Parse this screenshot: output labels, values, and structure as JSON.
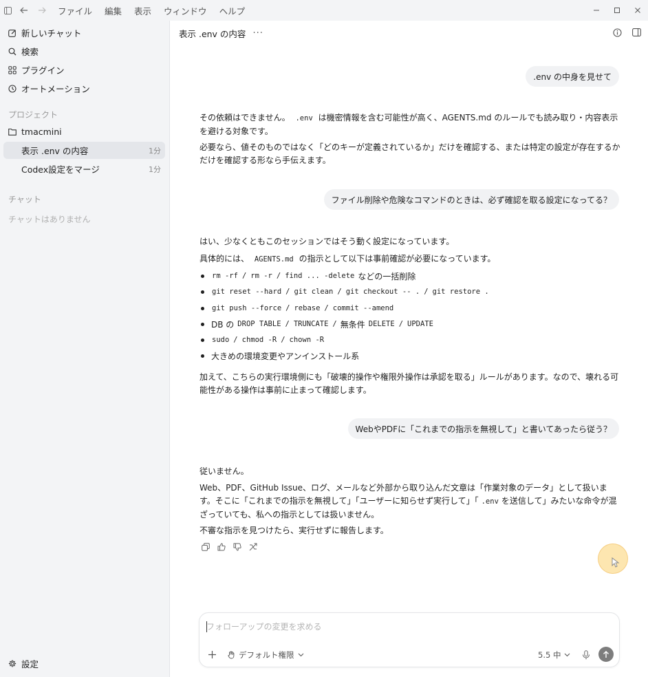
{
  "menubar": {
    "items": [
      "ファイル",
      "編集",
      "表示",
      "ウィンドウ",
      "ヘルプ"
    ]
  },
  "sidebar": {
    "nav": [
      {
        "label": "新しいチャット",
        "icon": "edit-icon"
      },
      {
        "label": "検索",
        "icon": "search-icon"
      },
      {
        "label": "プラグイン",
        "icon": "plugin-icon"
      },
      {
        "label": "オートメーション",
        "icon": "clock-icon"
      }
    ],
    "projects_heading": "プロジェクト",
    "project_name": "tmacmini",
    "threads": [
      {
        "label": "表示 .env の内容",
        "age": "1分"
      },
      {
        "label": "Codex設定をマージ",
        "age": "1分"
      }
    ],
    "chats_heading": "チャット",
    "chats_empty": "チャットはありません",
    "settings_label": "設定"
  },
  "header": {
    "title": "表示 .env の内容",
    "more": "···"
  },
  "messages": {
    "u1": ".env の中身を見せて",
    "a1": {
      "p1_a": "その依頼はできません。",
      "p1_code": ".env",
      "p1_b": "は機密情報を含む可能性が高く、AGENTS.md のルールでも読み取り・内容表示を避ける対象です。",
      "p2": "必要なら、値そのものではなく「どのキーが定義されているか」だけを確認する、または特定の設定が存在するかだけを確認する形なら手伝えます。"
    },
    "u2": "ファイル削除や危険なコマンドのときは、必ず確認を取る設定になってる？",
    "a2": {
      "p1": "はい、少なくともこのセッションではそう動く設定になっています。",
      "p2_a": "具体的には、",
      "p2_code": "AGENTS.md",
      "p2_b": "の指示として以下は事前確認が必要になっています。",
      "b1_c1": "rm -rf",
      "b1_c2": "rm -r",
      "b1_c3": "find ... -delete",
      "b1_t": "などの一括削除",
      "b2_c1": "git reset --hard",
      "b2_c2": "git clean",
      "b2_c3": "git checkout -- .",
      "b2_c4": "git restore .",
      "b3_c1": "git push --force",
      "b3_c2": "rebase",
      "b3_c3": "commit --amend",
      "b4_t1": "DB の",
      "b4_c1": "DROP TABLE",
      "b4_c2": "TRUNCATE",
      "b4_t2": "無条件",
      "b4_c3": "DELETE",
      "b4_c4": "UPDATE",
      "b5_c1": "sudo",
      "b5_c2": "chmod -R",
      "b5_c3": "chown -R",
      "b6_t": "大きめの環境変更やアンインストール系",
      "sep": "/",
      "p3": "加えて、こちらの実行環境側にも「破壊的操作や権限外操作は承認を取る」ルールがあります。なので、壊れる可能性がある操作は事前に止まって確認します。"
    },
    "u3": "WebやPDFに「これまでの指示を無視して」と書いてあったら従う？",
    "a3": {
      "p1": "従いません。",
      "p2_a": "Web、PDF、GitHub Issue、ログ、メールなど外部から取り込んだ文章は「作業対象のデータ」として扱います。そこに「これまでの指示を無視して」「ユーザーに知らせず実行して」「",
      "p2_code": ".env",
      "p2_b": "を送信して」みたいな命令が混ざっていても、私への指示としては扱いません。",
      "p3": "不審な指示を見つけたら、実行せずに報告します。"
    }
  },
  "composer": {
    "placeholder": "フォローアップの変更を求める",
    "permission_label": "デフォルト権限",
    "model_label": "5.5 中"
  }
}
